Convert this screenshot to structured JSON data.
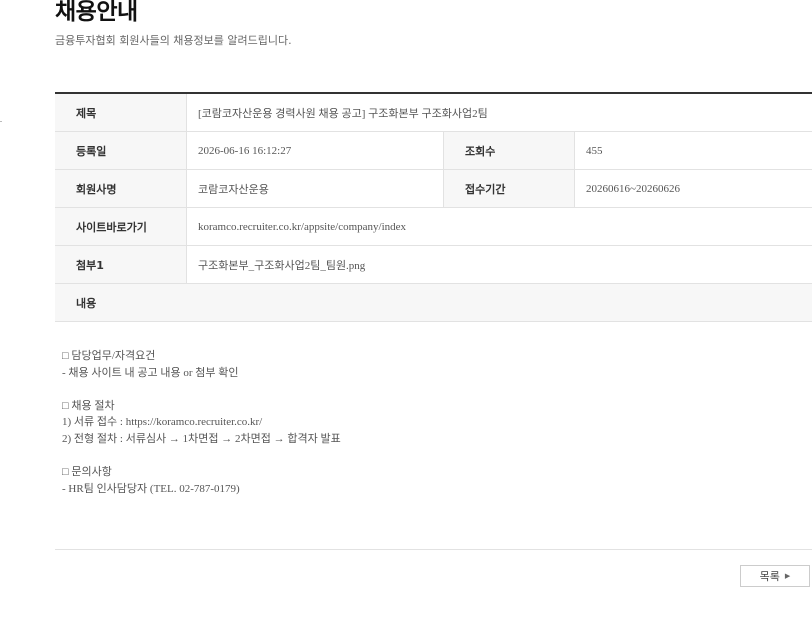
{
  "header": {
    "title": "채용안내",
    "subtitle": "금융투자협회 회원사들의 채용정보를 알려드립니다."
  },
  "detail": {
    "title_label": "제목",
    "title_value": "[코람코자산운용 경력사원 채용 공고] 구조화본부 구조화사업2팀",
    "date_label": "등록일",
    "date_value": "2026-06-16 16:12:27",
    "views_label": "조회수",
    "views_value": "455",
    "company_label": "회원사명",
    "company_value": "코람코자산운용",
    "period_label": "접수기간",
    "period_value": "20260616~20260626",
    "site_label": "사이트바로가기",
    "site_value": "koramco.recruiter.co.kr/appsite/company/index",
    "attach_label": "첨부1",
    "attach_value": "구조화본부_구조화사업2팀_팀원.png",
    "content_label": "내용"
  },
  "content": {
    "lines": [
      "□ 담당업무/자격요건",
      "- 채용 사이트 내 공고 내용 or 첨부 확인",
      "",
      "□ 채용 절차",
      "1) 서류 접수 : https://koramco.recruiter.co.kr/",
      "2) 전형 절차 : 서류심사 → 1차면접 → 2차면접 → 합격자 발표",
      "",
      "□ 문의사항",
      "- HR팀 인사담당자 (TEL. 02-787-0179)"
    ]
  },
  "footer": {
    "list_button_label": "목록",
    "list_button_icon": "triangle-right-icon"
  }
}
